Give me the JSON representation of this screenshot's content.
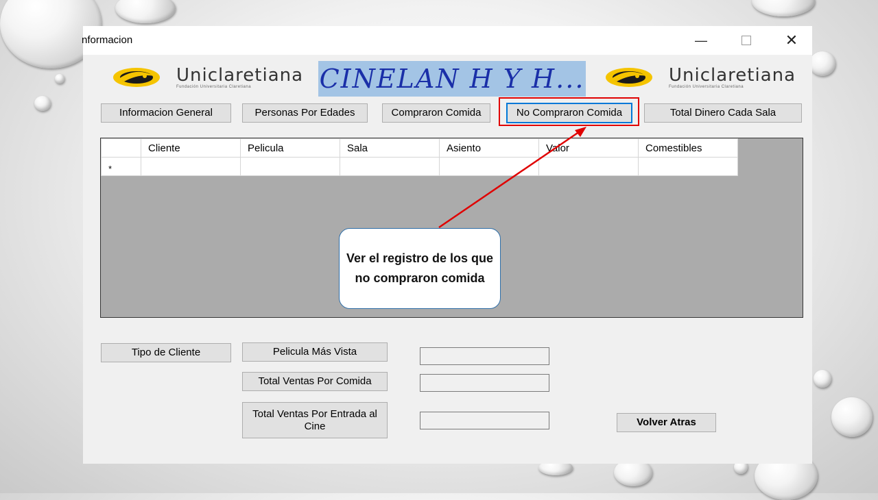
{
  "window": {
    "title": "nformacion",
    "controls": [
      "minimize-icon",
      "maximize-icon",
      "close-icon"
    ]
  },
  "header": {
    "logo_left": {
      "name": "Uniclaretiana",
      "subtitle": "Fundación Universitaria Claretiana"
    },
    "banner": "CINELAN H Y H...",
    "logo_right": {
      "name": "Uniclaretiana",
      "subtitle": "Fundación Universitaria Claretiana"
    },
    "brand_color": "#1a2fa8",
    "banner_bg": "#a3c4e5"
  },
  "nav_buttons": [
    "Informacion General",
    "Personas Por Edades",
    "Compraron Comida",
    "No Compraron Comida",
    "Total Dinero Cada Sala"
  ],
  "grid": {
    "columns": [
      "Cliente",
      "Pelicula",
      "Sala",
      "Asiento",
      "Valor",
      "Comestibles"
    ],
    "new_row_marker": "*"
  },
  "bottom": {
    "tipo_cliente": "Tipo de Cliente",
    "pelicula_mas_vista": "Pelicula Más Vista",
    "total_ventas_comida": "Total Ventas Por Comida",
    "total_ventas_entrada": "Total Ventas Por Entrada al Cine",
    "volver": "Volver Atras",
    "fields": [
      "",
      "",
      ""
    ]
  },
  "annotation": {
    "callout_text": "Ver el registro de los que no compraron comida",
    "highlight_color": "#e00000"
  }
}
